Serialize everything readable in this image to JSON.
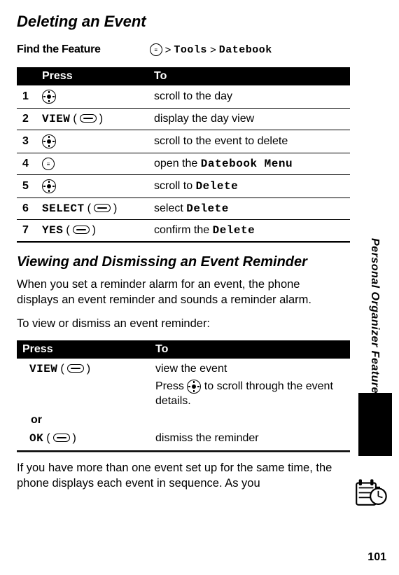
{
  "page_number": "101",
  "side_label": "Personal Organizer Features",
  "heading_delete": "Deleting an Event",
  "find_feature_label": "Find the Feature",
  "breadcrumb": {
    "tools": "Tools",
    "datebook": "Datebook",
    "sep": ">"
  },
  "table1": {
    "head_press": "Press",
    "head_to": "To",
    "rows": [
      {
        "n": "1",
        "press_type": "nav",
        "to": "scroll to the day"
      },
      {
        "n": "2",
        "press_type": "soft",
        "press_label": "VIEW",
        "to": "display the day view"
      },
      {
        "n": "3",
        "press_type": "nav",
        "to": "scroll to the event to delete"
      },
      {
        "n": "4",
        "press_type": "menu",
        "to_prefix": "open the ",
        "to_ocr": "Datebook Menu"
      },
      {
        "n": "5",
        "press_type": "nav",
        "to_prefix": "scroll to ",
        "to_ocr": "Delete"
      },
      {
        "n": "6",
        "press_type": "soft",
        "press_label": "SELECT",
        "to_prefix": "select ",
        "to_ocr": "Delete"
      },
      {
        "n": "7",
        "press_type": "soft",
        "press_label": "YES",
        "to_prefix": "confirm the ",
        "to_ocr": "Delete"
      }
    ]
  },
  "heading_reminder": "Viewing and Dismissing an Event Reminder",
  "para1": "When you set a reminder alarm for an event, the phone displays an event reminder and sounds a reminder alarm.",
  "para2": "To view or dismiss an event reminder:",
  "table2": {
    "head_press": "Press",
    "head_to": "To",
    "view_label": "VIEW",
    "view_to": "view the event",
    "view_sub_pre": "Press ",
    "view_sub_post": " to scroll through the event details.",
    "or": "or",
    "ok_label": "OK",
    "ok_to": "dismiss the reminder"
  },
  "para3": "If you have more than one event set up for the same time, the phone displays each event in sequence. As you"
}
